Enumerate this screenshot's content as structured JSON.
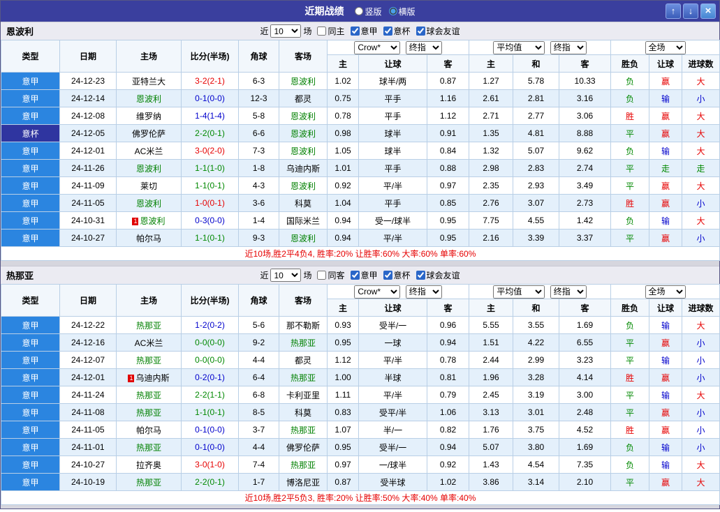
{
  "titlebar": {
    "title": "近期战绩",
    "vertical_label": "竖版",
    "horizontal_label": "横版",
    "vertical_checked": false,
    "horizontal_checked": true,
    "up_icon": "↑",
    "down_icon": "↓",
    "close_icon": "×"
  },
  "controls": {
    "provider": "Crow*",
    "provider_final": "终指",
    "average": "平均值",
    "average_final": "终指",
    "fullmatch": "全场"
  },
  "headers": {
    "type": "类型",
    "date": "日期",
    "home": "主场",
    "score": "比分(半场)",
    "corner": "角球",
    "away": "客场",
    "h_home": "主",
    "h_handicap": "让球",
    "h_away": "客",
    "a_home": "主",
    "a_draw": "和",
    "a_away": "客",
    "r_result": "胜负",
    "r_handicap": "让球",
    "r_goals": "进球数"
  },
  "colors": {
    "score": {
      "red": "#e60000",
      "green": "#008800",
      "blue": "#0000cc"
    },
    "result": {
      "胜": "#e60000",
      "平": "#008800",
      "负": "#008800",
      "赢": "#e60000",
      "输": "#0000cc",
      "走": "#008800",
      "大": "#e60000",
      "小": "#0000cc"
    },
    "focus_team": "#008000",
    "league_bg": {
      "意甲": "#2b85e0",
      "意杯": "#2f35a0"
    }
  },
  "sections": [
    {
      "team": "恩波利",
      "filters": {
        "near": "近",
        "count": "10",
        "games": "场",
        "same_label": "同主",
        "same_checked": false,
        "league_options": [
          {
            "label": "意甲",
            "checked": true
          },
          {
            "label": "意杯",
            "checked": true
          },
          {
            "label": "球会友谊",
            "checked": true
          }
        ]
      },
      "rows": [
        {
          "league": "意甲",
          "date": "24-12-23",
          "home": "亚特兰大",
          "home_card": "",
          "home_focus": false,
          "score": "3-2(2-1)",
          "score_color": "red",
          "corner": "6-3",
          "away": "恩波利",
          "away_card": "",
          "away_focus": true,
          "odds_home": "1.02",
          "handicap": "球半/两",
          "odds_away": "0.87",
          "avg_home": "1.27",
          "avg_draw": "5.78",
          "avg_away": "10.33",
          "res_result": "负",
          "res_handicap": "赢",
          "res_goals": "大"
        },
        {
          "league": "意甲",
          "date": "24-12-14",
          "home": "恩波利",
          "home_card": "",
          "home_focus": true,
          "score": "0-1(0-0)",
          "score_color": "blue",
          "corner": "12-3",
          "away": "都灵",
          "away_card": "",
          "away_focus": false,
          "odds_home": "0.75",
          "handicap": "平手",
          "odds_away": "1.16",
          "avg_home": "2.61",
          "avg_draw": "2.81",
          "avg_away": "3.16",
          "res_result": "负",
          "res_handicap": "输",
          "res_goals": "小"
        },
        {
          "league": "意甲",
          "date": "24-12-08",
          "home": "维罗纳",
          "home_card": "",
          "home_focus": false,
          "score": "1-4(1-4)",
          "score_color": "blue",
          "corner": "5-8",
          "away": "恩波利",
          "away_card": "",
          "away_focus": true,
          "odds_home": "0.78",
          "handicap": "平手",
          "odds_away": "1.12",
          "avg_home": "2.71",
          "avg_draw": "2.77",
          "avg_away": "3.06",
          "res_result": "胜",
          "res_handicap": "赢",
          "res_goals": "大"
        },
        {
          "league": "意杯",
          "date": "24-12-05",
          "home": "佛罗伦萨",
          "home_card": "",
          "home_focus": false,
          "score": "2-2(0-1)",
          "score_color": "green",
          "corner": "6-6",
          "away": "恩波利",
          "away_card": "",
          "away_focus": true,
          "odds_home": "0.98",
          "handicap": "球半",
          "odds_away": "0.91",
          "avg_home": "1.35",
          "avg_draw": "4.81",
          "avg_away": "8.88",
          "res_result": "平",
          "res_handicap": "赢",
          "res_goals": "大"
        },
        {
          "league": "意甲",
          "date": "24-12-01",
          "home": "AC米兰",
          "home_card": "",
          "home_focus": false,
          "score": "3-0(2-0)",
          "score_color": "red",
          "corner": "7-3",
          "away": "恩波利",
          "away_card": "",
          "away_focus": true,
          "odds_home": "1.05",
          "handicap": "球半",
          "odds_away": "0.84",
          "avg_home": "1.32",
          "avg_draw": "5.07",
          "avg_away": "9.62",
          "res_result": "负",
          "res_handicap": "输",
          "res_goals": "大"
        },
        {
          "league": "意甲",
          "date": "24-11-26",
          "home": "恩波利",
          "home_card": "",
          "home_focus": true,
          "score": "1-1(1-0)",
          "score_color": "green",
          "corner": "1-8",
          "away": "乌迪内斯",
          "away_card": "",
          "away_focus": false,
          "odds_home": "1.01",
          "handicap": "平手",
          "odds_away": "0.88",
          "avg_home": "2.98",
          "avg_draw": "2.83",
          "avg_away": "2.74",
          "res_result": "平",
          "res_handicap": "走",
          "res_goals": "走"
        },
        {
          "league": "意甲",
          "date": "24-11-09",
          "home": "莱切",
          "home_card": "",
          "home_focus": false,
          "score": "1-1(0-1)",
          "score_color": "green",
          "corner": "4-3",
          "away": "恩波利",
          "away_card": "",
          "away_focus": true,
          "odds_home": "0.92",
          "handicap": "平/半",
          "odds_away": "0.97",
          "avg_home": "2.35",
          "avg_draw": "2.93",
          "avg_away": "3.49",
          "res_result": "平",
          "res_handicap": "赢",
          "res_goals": "大"
        },
        {
          "league": "意甲",
          "date": "24-11-05",
          "home": "恩波利",
          "home_card": "",
          "home_focus": true,
          "score": "1-0(0-1)",
          "score_color": "red",
          "corner": "3-6",
          "away": "科莫",
          "away_card": "",
          "away_focus": false,
          "odds_home": "1.04",
          "handicap": "平手",
          "odds_away": "0.85",
          "avg_home": "2.76",
          "avg_draw": "3.07",
          "avg_away": "2.73",
          "res_result": "胜",
          "res_handicap": "赢",
          "res_goals": "小"
        },
        {
          "league": "意甲",
          "date": "24-10-31",
          "home": "恩波利",
          "home_card": "1",
          "home_focus": true,
          "score": "0-3(0-0)",
          "score_color": "blue",
          "corner": "1-4",
          "away": "国际米兰",
          "away_card": "",
          "away_focus": false,
          "odds_home": "0.94",
          "handicap": "受一/球半",
          "odds_away": "0.95",
          "avg_home": "7.75",
          "avg_draw": "4.55",
          "avg_away": "1.42",
          "res_result": "负",
          "res_handicap": "输",
          "res_goals": "大"
        },
        {
          "league": "意甲",
          "date": "24-10-27",
          "home": "帕尔马",
          "home_card": "",
          "home_focus": false,
          "score": "1-1(0-1)",
          "score_color": "green",
          "corner": "9-3",
          "away": "恩波利",
          "away_card": "",
          "away_focus": true,
          "odds_home": "0.94",
          "handicap": "平/半",
          "odds_away": "0.95",
          "avg_home": "2.16",
          "avg_draw": "3.39",
          "avg_away": "3.37",
          "res_result": "平",
          "res_handicap": "赢",
          "res_goals": "小"
        }
      ],
      "summary": "近10场,胜2平4负4, 胜率:20% 让胜率:60% 大率:60% 单率:60%"
    },
    {
      "team": "热那亚",
      "filters": {
        "near": "近",
        "count": "10",
        "games": "场",
        "same_label": "同客",
        "same_checked": false,
        "league_options": [
          {
            "label": "意甲",
            "checked": true
          },
          {
            "label": "意杯",
            "checked": true
          },
          {
            "label": "球会友谊",
            "checked": true
          }
        ]
      },
      "rows": [
        {
          "league": "意甲",
          "date": "24-12-22",
          "home": "热那亚",
          "home_card": "",
          "home_focus": true,
          "score": "1-2(0-2)",
          "score_color": "blue",
          "corner": "5-6",
          "away": "那不勒斯",
          "away_card": "",
          "away_focus": false,
          "odds_home": "0.93",
          "handicap": "受半/一",
          "odds_away": "0.96",
          "avg_home": "5.55",
          "avg_draw": "3.55",
          "avg_away": "1.69",
          "res_result": "负",
          "res_handicap": "输",
          "res_goals": "大"
        },
        {
          "league": "意甲",
          "date": "24-12-16",
          "home": "AC米兰",
          "home_card": "",
          "home_focus": false,
          "score": "0-0(0-0)",
          "score_color": "green",
          "corner": "9-2",
          "away": "热那亚",
          "away_card": "",
          "away_focus": true,
          "odds_home": "0.95",
          "handicap": "一球",
          "odds_away": "0.94",
          "avg_home": "1.51",
          "avg_draw": "4.22",
          "avg_away": "6.55",
          "res_result": "平",
          "res_handicap": "赢",
          "res_goals": "小"
        },
        {
          "league": "意甲",
          "date": "24-12-07",
          "home": "热那亚",
          "home_card": "",
          "home_focus": true,
          "score": "0-0(0-0)",
          "score_color": "green",
          "corner": "4-4",
          "away": "都灵",
          "away_card": "",
          "away_focus": false,
          "odds_home": "1.12",
          "handicap": "平/半",
          "odds_away": "0.78",
          "avg_home": "2.44",
          "avg_draw": "2.99",
          "avg_away": "3.23",
          "res_result": "平",
          "res_handicap": "输",
          "res_goals": "小"
        },
        {
          "league": "意甲",
          "date": "24-12-01",
          "home": "乌迪内斯",
          "home_card": "1",
          "home_focus": false,
          "score": "0-2(0-1)",
          "score_color": "blue",
          "corner": "6-4",
          "away": "热那亚",
          "away_card": "",
          "away_focus": true,
          "odds_home": "1.00",
          "handicap": "半球",
          "odds_away": "0.81",
          "avg_home": "1.96",
          "avg_draw": "3.28",
          "avg_away": "4.14",
          "res_result": "胜",
          "res_handicap": "赢",
          "res_goals": "小"
        },
        {
          "league": "意甲",
          "date": "24-11-24",
          "home": "热那亚",
          "home_card": "",
          "home_focus": true,
          "score": "2-2(1-1)",
          "score_color": "green",
          "corner": "6-8",
          "away": "卡利亚里",
          "away_card": "",
          "away_focus": false,
          "odds_home": "1.11",
          "handicap": "平/半",
          "odds_away": "0.79",
          "avg_home": "2.45",
          "avg_draw": "3.19",
          "avg_away": "3.00",
          "res_result": "平",
          "res_handicap": "输",
          "res_goals": "大"
        },
        {
          "league": "意甲",
          "date": "24-11-08",
          "home": "热那亚",
          "home_card": "",
          "home_focus": true,
          "score": "1-1(0-1)",
          "score_color": "green",
          "corner": "8-5",
          "away": "科莫",
          "away_card": "",
          "away_focus": false,
          "odds_home": "0.83",
          "handicap": "受平/半",
          "odds_away": "1.06",
          "avg_home": "3.13",
          "avg_draw": "3.01",
          "avg_away": "2.48",
          "res_result": "平",
          "res_handicap": "赢",
          "res_goals": "小"
        },
        {
          "league": "意甲",
          "date": "24-11-05",
          "home": "帕尔马",
          "home_card": "",
          "home_focus": false,
          "score": "0-1(0-0)",
          "score_color": "blue",
          "corner": "3-7",
          "away": "热那亚",
          "away_card": "",
          "away_focus": true,
          "odds_home": "1.07",
          "handicap": "半/一",
          "odds_away": "0.82",
          "avg_home": "1.76",
          "avg_draw": "3.75",
          "avg_away": "4.52",
          "res_result": "胜",
          "res_handicap": "赢",
          "res_goals": "小"
        },
        {
          "league": "意甲",
          "date": "24-11-01",
          "home": "热那亚",
          "home_card": "",
          "home_focus": true,
          "score": "0-1(0-0)",
          "score_color": "blue",
          "corner": "4-4",
          "away": "佛罗伦萨",
          "away_card": "",
          "away_focus": false,
          "odds_home": "0.95",
          "handicap": "受半/一",
          "odds_away": "0.94",
          "avg_home": "5.07",
          "avg_draw": "3.80",
          "avg_away": "1.69",
          "res_result": "负",
          "res_handicap": "输",
          "res_goals": "小"
        },
        {
          "league": "意甲",
          "date": "24-10-27",
          "home": "拉齐奥",
          "home_card": "",
          "home_focus": false,
          "score": "3-0(1-0)",
          "score_color": "red",
          "corner": "7-4",
          "away": "热那亚",
          "away_card": "",
          "away_focus": true,
          "odds_home": "0.97",
          "handicap": "一/球半",
          "odds_away": "0.92",
          "avg_home": "1.43",
          "avg_draw": "4.54",
          "avg_away": "7.35",
          "res_result": "负",
          "res_handicap": "输",
          "res_goals": "大"
        },
        {
          "league": "意甲",
          "date": "24-10-19",
          "home": "热那亚",
          "home_card": "",
          "home_focus": true,
          "score": "2-2(0-1)",
          "score_color": "green",
          "corner": "1-7",
          "away": "博洛尼亚",
          "away_card": "",
          "away_focus": false,
          "odds_home": "0.87",
          "handicap": "受半球",
          "odds_away": "1.02",
          "avg_home": "3.86",
          "avg_draw": "3.14",
          "avg_away": "2.10",
          "res_result": "平",
          "res_handicap": "赢",
          "res_goals": "大"
        }
      ],
      "summary": "近10场,胜2平5负3, 胜率:20% 让胜率:50% 大率:40% 单率:40%"
    }
  ]
}
